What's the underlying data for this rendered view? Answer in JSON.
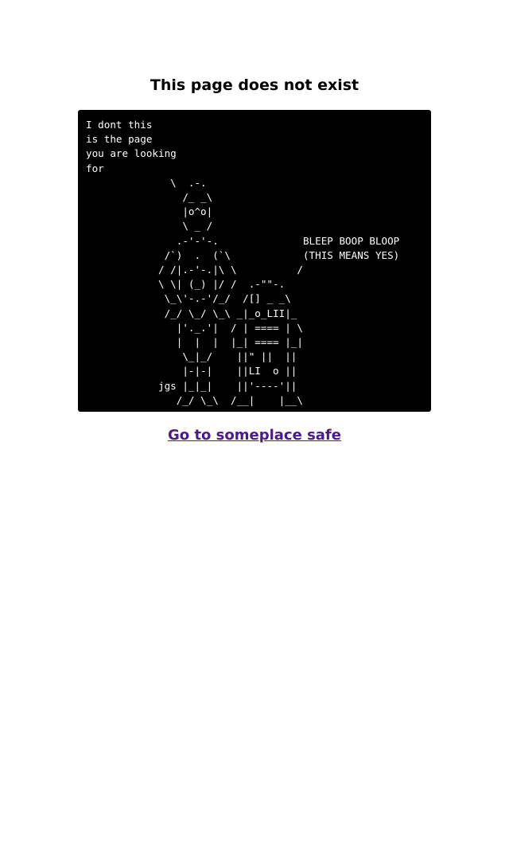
{
  "heading": "This page does not exist",
  "ascii_art": "I dont this\nis the page\nyou are looking\nfor\n              \\  .-.\n                /_ _\\\n                |o^o|\n                \\ _ /\n               .-'-'-.              BLEEP BOOP BLOOP\n             /`)  .  (`\\            (THIS MEANS YES)\n            / /|.-'-.|\\ \\          /\n            \\ \\| (_) |/ /  .-\"\"-.\n             \\_\\'-.-'/_/  /[] _ _\\\n             /_/ \\_/ \\_\\ _|_o_LII|_\n               |'._.'|  / | ==== | \\\n               |  |  |  |_| ==== |_|\n                \\_|_/    ||\" ||  ||\n                |-|-|    ||LI  o ||\n            jgs |_|_|    ||'----'||\n               /_/ \\_\\  /__|    |__\\",
  "link_text": "Go to someplace safe",
  "colors": {
    "background": "#ffffff",
    "terminal_bg": "#000000",
    "terminal_text": "#ffffff",
    "link": "#4b1a8c"
  }
}
